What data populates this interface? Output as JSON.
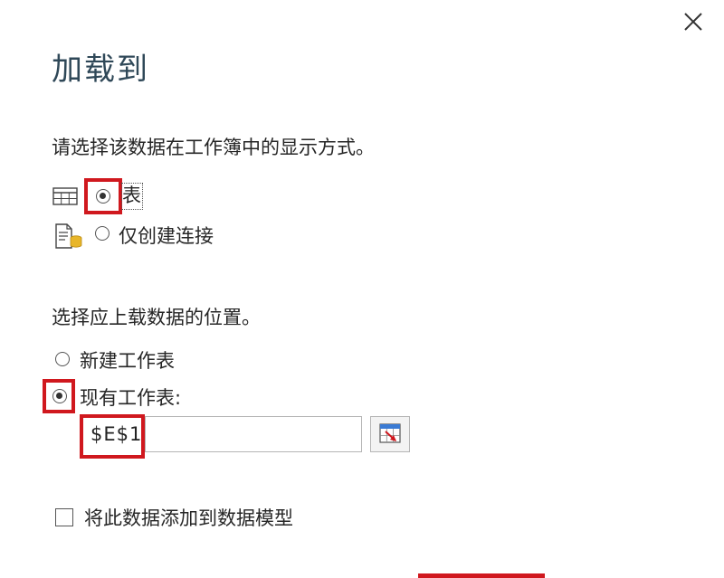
{
  "dialog": {
    "title": "加载到",
    "close_icon": "close-icon"
  },
  "display_section": {
    "prompt": "请选择该数据在工作簿中的显示方式。",
    "options": [
      {
        "label": "表",
        "icon": "table-icon",
        "selected": true
      },
      {
        "label": "仅创建连接",
        "icon": "connection-only-icon",
        "selected": false
      }
    ]
  },
  "location_section": {
    "prompt": "选择应上载数据的位置。",
    "options": [
      {
        "label": "新建工作表",
        "selected": false
      },
      {
        "label": "现有工作表:",
        "selected": true
      }
    ],
    "cell_reference": "$E$1",
    "picker_icon": "range-select-icon"
  },
  "data_model": {
    "label": "将此数据添加到数据模型",
    "checked": false
  },
  "colors": {
    "highlight": "#d0181e",
    "title": "#2f4858"
  }
}
